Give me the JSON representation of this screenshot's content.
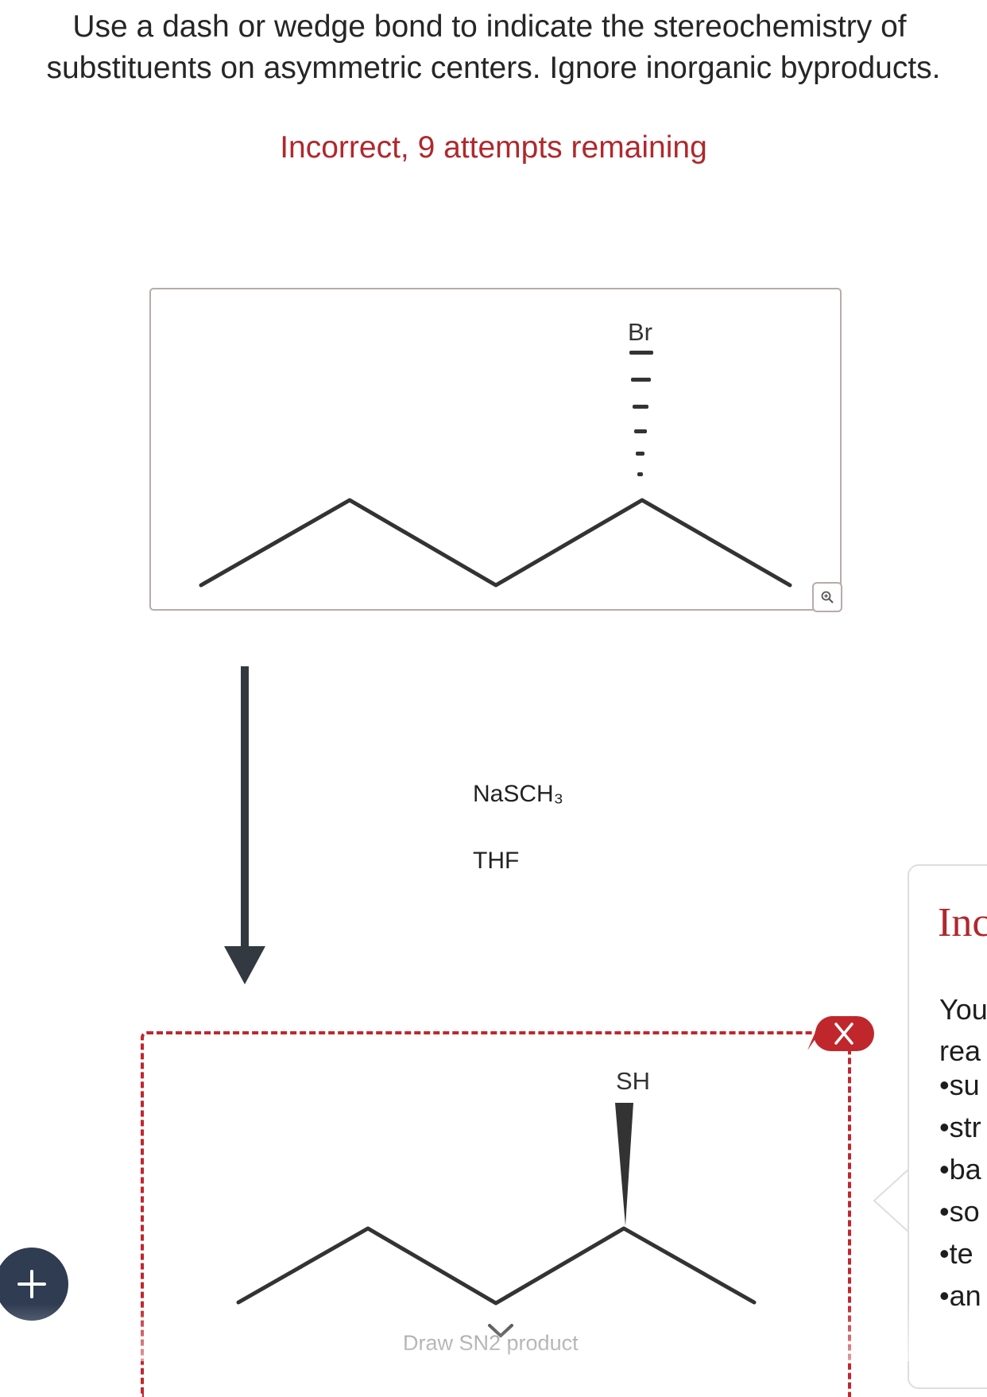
{
  "instructions": {
    "line1": "Use a dash or wedge bond to indicate the stereochemistry of",
    "line2": "substituents on asymmetric centers. Ignore inorganic byproducts."
  },
  "status": {
    "text": "Incorrect, 9 attempts remaining",
    "color": "#b0282d"
  },
  "reactant": {
    "substituent_label": "Br",
    "bond_type": "dash",
    "zoom_icon": "zoom-in-icon"
  },
  "reaction": {
    "reagent_1": "NaSCH₃",
    "reagent_2": "THF",
    "arrow_icon": "down-arrow-icon"
  },
  "answer": {
    "substituent_label": "SH",
    "bond_type": "wedge",
    "draw_label": "Draw SN2 product",
    "error_icon": "close-icon",
    "border_color": "#c0272d"
  },
  "add_button": {
    "icon": "plus-icon"
  },
  "feedback": {
    "title": "Inc",
    "line1": "You",
    "line2": "rea",
    "bullets": [
      "su",
      "str",
      "ba",
      "so",
      "te",
      "an"
    ]
  }
}
